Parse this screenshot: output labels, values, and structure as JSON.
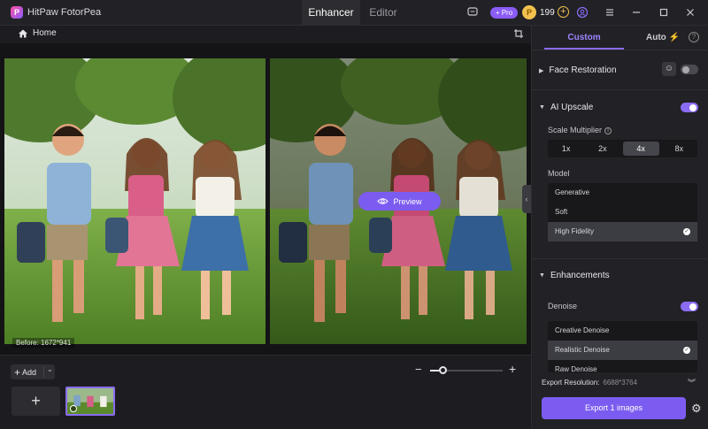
{
  "app": {
    "title": "HitPaw FotorPea",
    "logo_letter": "P"
  },
  "top_tabs": [
    {
      "label": "Enhancer",
      "active": true
    },
    {
      "label": "Editor",
      "active": false
    }
  ],
  "titlebar": {
    "pro_label": "+ Pro",
    "coin_count": "199"
  },
  "breadcrumb": {
    "home_label": "Home"
  },
  "canvas": {
    "before_label": "Before: 1672*941",
    "preview_label": "Preview"
  },
  "bottom": {
    "add_label": "Add",
    "zoom_level": 0.17
  },
  "panel": {
    "tabs": {
      "custom": "Custom",
      "auto": "Auto"
    },
    "face_restoration": {
      "label": "Face Restoration",
      "enabled": false
    },
    "ai_upscale": {
      "label": "AI Upscale",
      "enabled": true,
      "scale_label": "Scale Multiplier",
      "scale_options": [
        "1x",
        "2x",
        "4x",
        "8x"
      ],
      "scale_selected": "4x",
      "model_label": "Model",
      "models": [
        "Generative",
        "Soft",
        "High Fidelity"
      ],
      "model_selected": "High Fidelity"
    },
    "enhancements": {
      "label": "Enhancements",
      "denoise_label": "Denoise",
      "denoise_enabled": true,
      "denoise_options": [
        "Creative Denoise",
        "Realistic Denoise",
        "Raw Denoise"
      ],
      "denoise_selected": "Realistic Denoise"
    },
    "export": {
      "resolution_label": "Export Resolution:",
      "resolution_value": "6688*3764",
      "button_label": "Export 1 images"
    }
  },
  "colors": {
    "accent": "#7c5cf0",
    "panel_bg": "#222226",
    "workspace_bg": "#141417"
  }
}
